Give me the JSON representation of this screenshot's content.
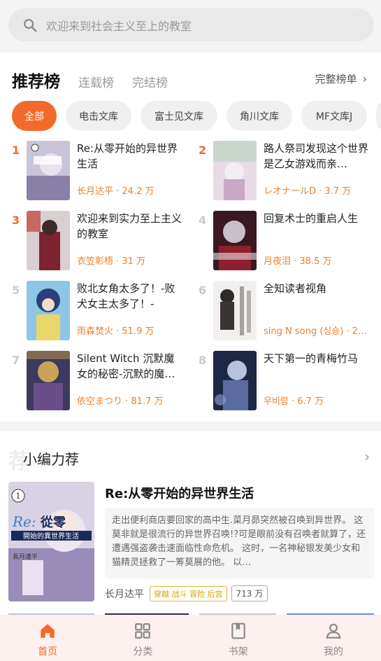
{
  "search": {
    "placeholder": "欢迎来到社会主义至上的教室"
  },
  "ranking": {
    "tabs": [
      {
        "label": "推荐榜",
        "active": true
      },
      {
        "label": "连载榜",
        "active": false
      },
      {
        "label": "完结榜",
        "active": false
      }
    ],
    "full_rank_label": "完整榜单",
    "filters": [
      {
        "label": "全部",
        "active": true
      },
      {
        "label": "电击文库",
        "active": false
      },
      {
        "label": "富士见文库",
        "active": false
      },
      {
        "label": "角川文库",
        "active": false
      },
      {
        "label": "MF文库J",
        "active": false
      }
    ],
    "items": [
      {
        "rank": "1",
        "title": "Re:从零开始的异世界生活",
        "meta": "长月达平 · 24.2 万"
      },
      {
        "rank": "2",
        "title": "路人祭司发现这个世界是乙女游戏而亲…",
        "meta": "レオナールD · 3.7 万"
      },
      {
        "rank": "3",
        "title": "欢迎来到实力至上主义的教室",
        "meta": "衣笠彰梧 · 31 万"
      },
      {
        "rank": "4",
        "title": "回复术士的重启人生",
        "meta": "月夜泪 · 38.5 万"
      },
      {
        "rank": "5",
        "title": "败北女角太多了！-败犬女主太多了！-",
        "meta": "雨森焚火 · 51.9 万"
      },
      {
        "rank": "6",
        "title": "全知读者视角",
        "meta": "sing N song (싱숑) · 28…"
      },
      {
        "rank": "7",
        "title": "Silent Witch 沉默魔女的秘密-沉默的魔…",
        "meta": "依空まつり · 81.7 万"
      },
      {
        "rank": "8",
        "title": "天下第一的青梅竹马",
        "meta": "우비람 · 6.7 万"
      }
    ]
  },
  "editor_pick": {
    "deco": "荐",
    "title": "小编力荐",
    "book": {
      "title": "Re:从零开始的异世界生活",
      "description": "走出便利商店要回家的高中生.菜月昴突然被召唤到异世界。 这莫非就是很流行的异世界召唤!?可是眼前没有召唤者就算了，还遭遇强盗袭击速面临性命危机。 这时，一名神秘银发美少女和猫精灵拯救了一筹莫展的他。 以…",
      "author": "长月达平",
      "tags": "穿越 战斗 冒险 后宫",
      "count": "713 万",
      "cover_text_volume": "1",
      "cover_text_re": "Re:",
      "cover_text_zero": "從零",
      "cover_text_sub": "開始的異世界生活",
      "cover_text_author": "長月達平"
    }
  },
  "tabbar": [
    {
      "label": "首页",
      "icon": "home-icon",
      "active": true
    },
    {
      "label": "分类",
      "icon": "grid-icon",
      "active": false
    },
    {
      "label": "书架",
      "icon": "bookshelf-icon",
      "active": false
    },
    {
      "label": "我的",
      "icon": "user-icon",
      "active": false
    }
  ],
  "colors": {
    "accent": "#f36b2a",
    "rank_meta": "#e8822a",
    "tag": "#d9a300"
  }
}
